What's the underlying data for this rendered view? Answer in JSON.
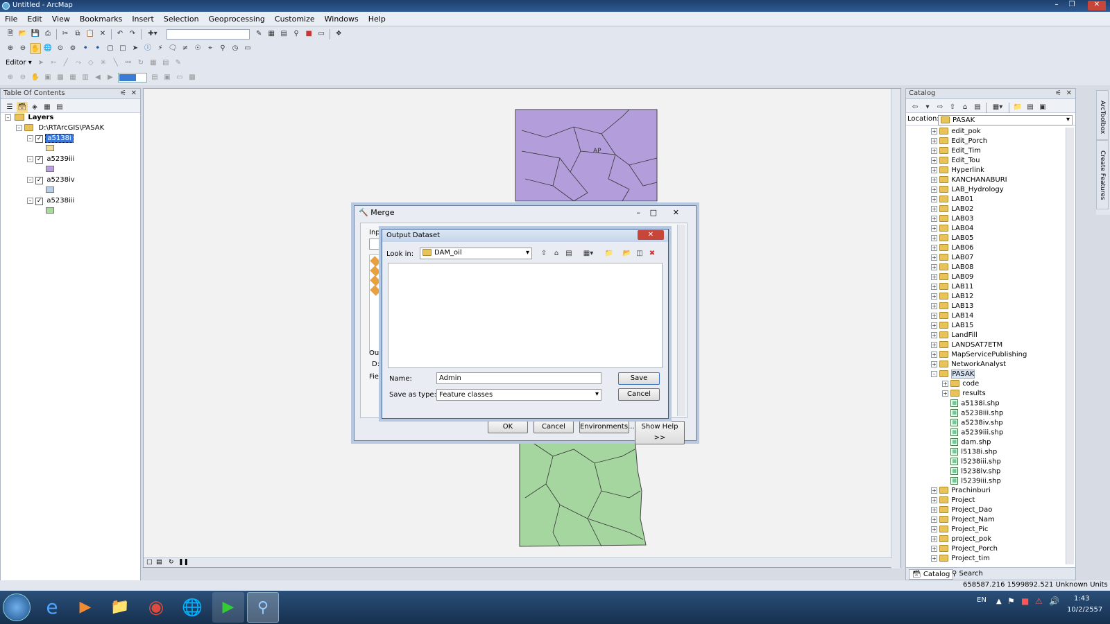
{
  "window": {
    "title": "Untitled - ArcMap"
  },
  "menu": [
    "File",
    "Edit",
    "View",
    "Bookmarks",
    "Insert",
    "Selection",
    "Geoprocessing",
    "Customize",
    "Windows",
    "Help"
  ],
  "editor_label": "Editor",
  "toc": {
    "title": "Table Of Contents",
    "root_label": "Layers",
    "folder_label": "D:\\RTArcGIS\\PASAK",
    "layers": [
      {
        "name": "a5138i",
        "color": "#f0dca0",
        "selected": true
      },
      {
        "name": "a5239iii",
        "color": "#b99fdb",
        "selected": false
      },
      {
        "name": "a5238iv",
        "color": "#b8cde8",
        "selected": false
      },
      {
        "name": "a5238iii",
        "color": "#a9d9a0",
        "selected": false
      }
    ]
  },
  "map": {
    "purple_color": "#b39ddb",
    "green_color": "#a5d6a0",
    "label": "AP"
  },
  "merge": {
    "title": "Merge",
    "input_label": "Inpu",
    "output_label": "Outp",
    "output_value": "D:",
    "field_label": "Field",
    "ok": "OK",
    "cancel": "Cancel",
    "environments": "Environments...",
    "show_help": "Show Help >>"
  },
  "output_dataset": {
    "title": "Output Dataset",
    "look_in_label": "Look in:",
    "look_in_value": "DAM_oil",
    "name_label": "Name:",
    "name_value": "Admin",
    "type_label": "Save as type:",
    "type_value": "Feature classes",
    "save": "Save",
    "cancel": "Cancel"
  },
  "catalog": {
    "title": "Catalog",
    "location_label": "Location:",
    "location_value": "PASAK",
    "items": [
      {
        "name": "edit_pok",
        "type": "folder",
        "level": 0
      },
      {
        "name": "Edit_Porch",
        "type": "folder",
        "level": 0
      },
      {
        "name": "Edit_Tim",
        "type": "folder",
        "level": 0
      },
      {
        "name": "Edit_Tou",
        "type": "folder",
        "level": 0
      },
      {
        "name": "Hyperlink",
        "type": "folder",
        "level": 0
      },
      {
        "name": "KANCHANABURI",
        "type": "folder",
        "level": 0
      },
      {
        "name": "LAB_Hydrology",
        "type": "folder",
        "level": 0
      },
      {
        "name": "LAB01",
        "type": "folder",
        "level": 0
      },
      {
        "name": "LAB02",
        "type": "folder",
        "level": 0
      },
      {
        "name": "LAB03",
        "type": "folder",
        "level": 0
      },
      {
        "name": "LAB04",
        "type": "folder",
        "level": 0
      },
      {
        "name": "LAB05",
        "type": "folder",
        "level": 0
      },
      {
        "name": "LAB06",
        "type": "folder",
        "level": 0
      },
      {
        "name": "LAB07",
        "type": "folder",
        "level": 0
      },
      {
        "name": "LAB08",
        "type": "folder",
        "level": 0
      },
      {
        "name": "LAB09",
        "type": "folder",
        "level": 0
      },
      {
        "name": "LAB11",
        "type": "folder",
        "level": 0
      },
      {
        "name": "LAB12",
        "type": "folder",
        "level": 0
      },
      {
        "name": "LAB13",
        "type": "folder",
        "level": 0
      },
      {
        "name": "LAB14",
        "type": "folder",
        "level": 0
      },
      {
        "name": "LAB15",
        "type": "folder",
        "level": 0
      },
      {
        "name": "LandFill",
        "type": "folder",
        "level": 0
      },
      {
        "name": "LANDSAT7ETM",
        "type": "folder",
        "level": 0
      },
      {
        "name": "MapServicePublishing",
        "type": "folder",
        "level": 0
      },
      {
        "name": "NetworkAnalyst",
        "type": "folder",
        "level": 0
      },
      {
        "name": "PASAK",
        "type": "folder-open",
        "level": 0,
        "selected": true
      },
      {
        "name": "code",
        "type": "folder",
        "level": 1
      },
      {
        "name": "results",
        "type": "folder",
        "level": 1
      },
      {
        "name": "a5138i.shp",
        "type": "shp",
        "level": 1
      },
      {
        "name": "a5238iii.shp",
        "type": "shp",
        "level": 1
      },
      {
        "name": "a5238iv.shp",
        "type": "shp",
        "level": 1
      },
      {
        "name": "a5239iii.shp",
        "type": "shp",
        "level": 1
      },
      {
        "name": "dam.shp",
        "type": "shp",
        "level": 1
      },
      {
        "name": "l5138i.shp",
        "type": "shp",
        "level": 1
      },
      {
        "name": "l5238iii.shp",
        "type": "shp",
        "level": 1
      },
      {
        "name": "l5238iv.shp",
        "type": "shp",
        "level": 1
      },
      {
        "name": "l5239iii.shp",
        "type": "shp",
        "level": 1
      },
      {
        "name": "Prachinburi",
        "type": "folder",
        "level": 0
      },
      {
        "name": "Project",
        "type": "folder",
        "level": 0
      },
      {
        "name": "Project_Dao",
        "type": "folder",
        "level": 0
      },
      {
        "name": "Project_Nam",
        "type": "folder",
        "level": 0
      },
      {
        "name": "Project_Pic",
        "type": "folder",
        "level": 0
      },
      {
        "name": "project_pok",
        "type": "folder",
        "level": 0
      },
      {
        "name": "Project_Porch",
        "type": "folder",
        "level": 0
      },
      {
        "name": "Project_tim",
        "type": "folder",
        "level": 0
      }
    ],
    "tabs": [
      "Catalog",
      "Search"
    ]
  },
  "side_tabs": [
    "ArcToolbox",
    "Create Features"
  ],
  "status": {
    "coords": "658587.216  1599892.521 Unknown Units"
  },
  "taskbar": {
    "lang": "EN",
    "time": "1:43",
    "date": "10/2/2557"
  }
}
